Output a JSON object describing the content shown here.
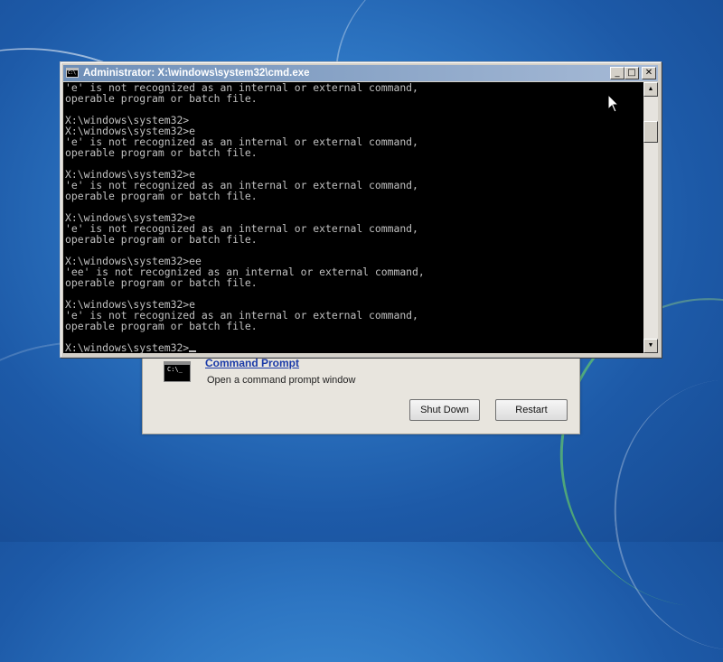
{
  "desktop": {
    "dialog": {
      "icon_text": "C:\\_",
      "link_label": "Command Prompt",
      "description": "Open a command prompt window",
      "shutdown_label": "Shut Down",
      "restart_label": "Restart"
    }
  },
  "cmd": {
    "icon_text": "C:\\",
    "title": "Administrator: X:\\windows\\system32\\cmd.exe",
    "buttons": {
      "minimize": "_",
      "maximize": "□",
      "close": "✕"
    },
    "output": "'e' is not recognized as an internal or external command,\noperable program or batch file.\n\nX:\\windows\\system32>\nX:\\windows\\system32>e\n'e' is not recognized as an internal or external command,\noperable program or batch file.\n\nX:\\windows\\system32>e\n'e' is not recognized as an internal or external command,\noperable program or batch file.\n\nX:\\windows\\system32>e\n'e' is not recognized as an internal or external command,\noperable program or batch file.\n\nX:\\windows\\system32>ee\n'ee' is not recognized as an internal or external command,\noperable program or batch file.\n\nX:\\windows\\system32>e\n'e' is not recognized as an internal or external command,\noperable program or batch file.\n",
    "prompt": "X:\\windows\\system32>",
    "scroll": {
      "up_icon": "▲",
      "down_icon": "▼"
    }
  }
}
